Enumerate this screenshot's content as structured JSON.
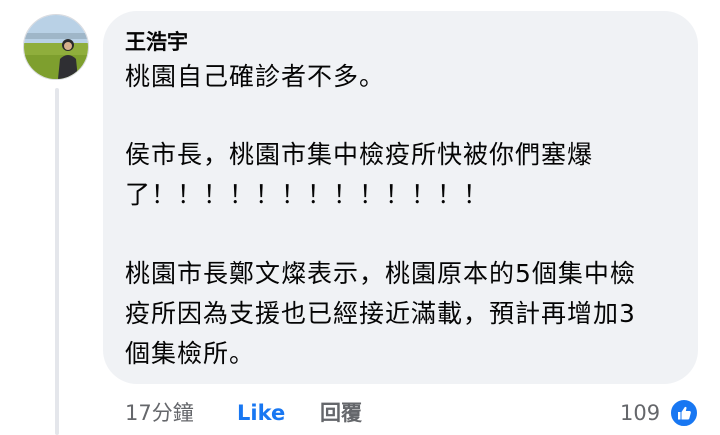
{
  "comment": {
    "author": "王浩宇",
    "paragraphs": [
      [
        "桃園自己確診者不多。"
      ],
      [
        "侯市長，桃園市集中檢疫所快被你們塞爆",
        "了！！！！！！！！！！！！！"
      ],
      [
        "桃園市長鄭文燦表示，桃園原本的5個集中檢",
        "疫所因為支援也已經接近滿載，預計再增加3",
        "個集檢所。"
      ]
    ]
  },
  "footer": {
    "timestamp": "17分鐘",
    "like_label": "Like",
    "reply_label": "回覆",
    "reaction_count": "109",
    "reaction_icon": "thumbs-up-icon"
  },
  "colors": {
    "bubble": "#f0f2f5",
    "accent": "#1877f2",
    "muted": "#65676b"
  }
}
